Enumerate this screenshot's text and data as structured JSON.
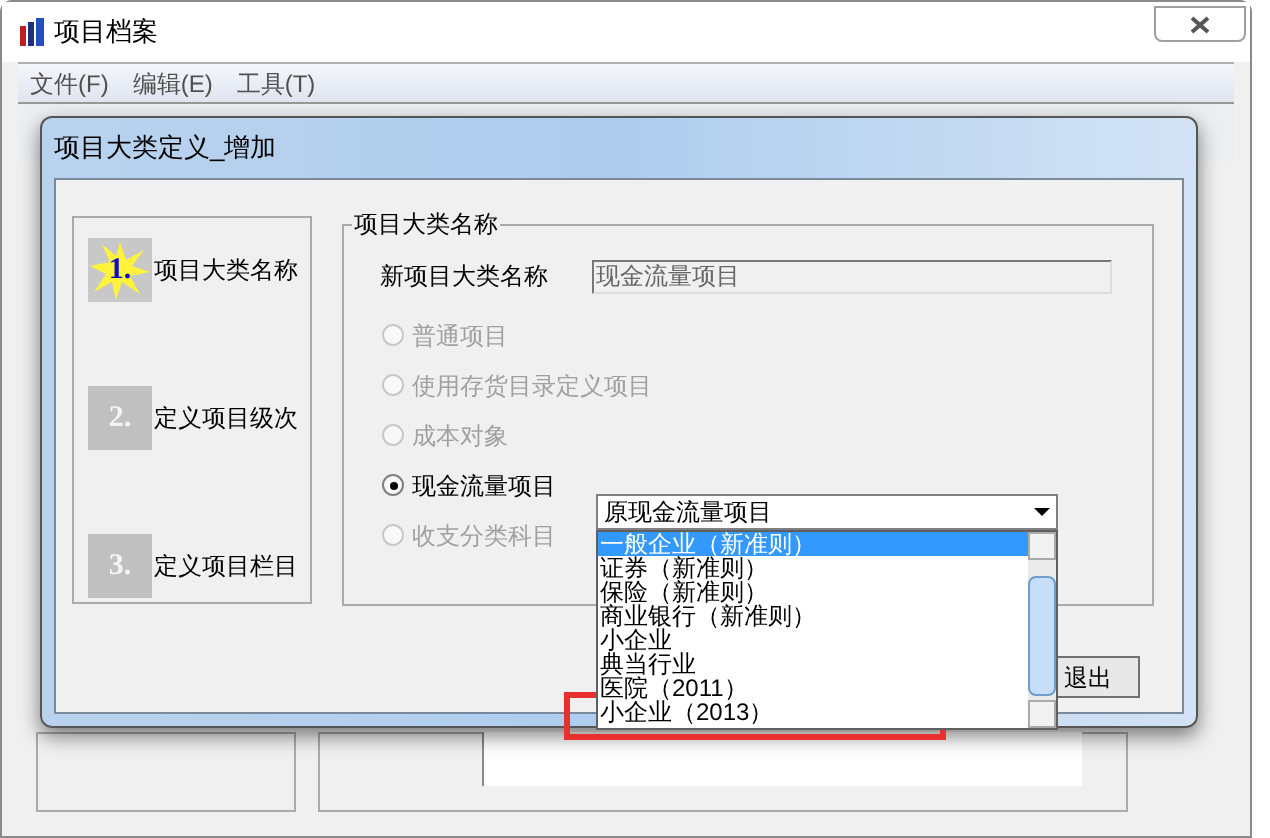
{
  "window": {
    "title": "项目档案"
  },
  "menu": [
    {
      "label": "文件(F)"
    },
    {
      "label": "编辑(E)"
    },
    {
      "label": "工具(T)"
    }
  ],
  "dialog": {
    "title": "项目大类定义_增加",
    "steps": [
      {
        "number": "1.",
        "label": "项目大类名称",
        "active": true
      },
      {
        "number": "2.",
        "label": "定义项目级次",
        "active": false
      },
      {
        "number": "3.",
        "label": "定义项目栏目",
        "active": false
      }
    ],
    "group_title": "项目大类名称",
    "name_field": {
      "label": "新项目大类名称",
      "value": "现金流量项目"
    },
    "options": [
      {
        "label": "普通项目",
        "selected": false,
        "disabled": true
      },
      {
        "label": "使用存货目录定义项目",
        "selected": false,
        "disabled": true
      },
      {
        "label": "成本对象",
        "selected": false,
        "disabled": true
      },
      {
        "label": "现金流量项目",
        "selected": true,
        "disabled": false
      },
      {
        "label": "收支分类科目",
        "selected": false,
        "disabled": true
      }
    ],
    "combo": {
      "value": "原现金流量项目",
      "items": [
        {
          "label": "一般企业（新准则）",
          "selected": true
        },
        {
          "label": "证券（新准则）",
          "selected": false
        },
        {
          "label": "保险（新准则）",
          "selected": false
        },
        {
          "label": "商业银行（新准则）",
          "selected": false
        },
        {
          "label": "小企业",
          "selected": false
        },
        {
          "label": "典当行业",
          "selected": false
        },
        {
          "label": "医院（2011）",
          "selected": false
        },
        {
          "label": "小企业（2013）",
          "selected": false
        }
      ]
    },
    "buttons": [
      {
        "label": "退出"
      }
    ]
  }
}
